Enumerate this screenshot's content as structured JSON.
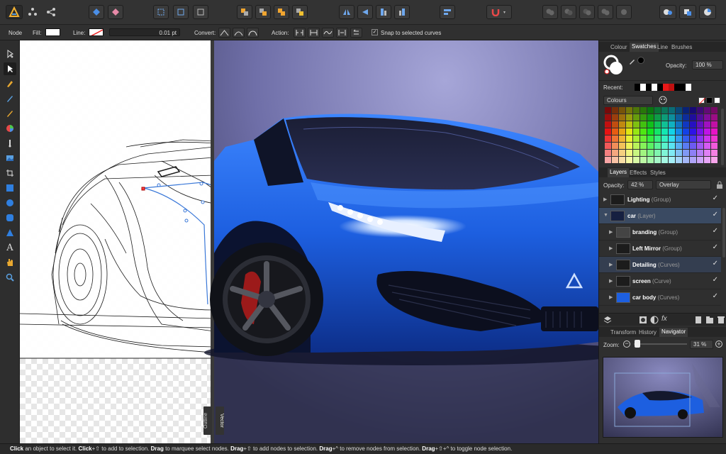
{
  "context_bar": {
    "mode": "Node",
    "fill_label": "Fill:",
    "line_label": "Line:",
    "line_width": "0.01 pt",
    "convert_label": "Convert:",
    "action_label": "Action:",
    "snap_label": "Snap to selected curves"
  },
  "colour_panel": {
    "tabs": [
      "Colour",
      "Swatches",
      "Line",
      "Brushes"
    ],
    "active_tab": "Swatches",
    "opacity_label": "Opacity:",
    "opacity_value": "100 %",
    "recent_label": "Recent:",
    "palette_name": "Colours"
  },
  "layers_panel": {
    "tabs": [
      "Layers",
      "Effects",
      "Styles"
    ],
    "active_tab": "Layers",
    "opacity_label": "Opacity:",
    "opacity_value": "42 %",
    "blend_mode": "Overlay",
    "layers": [
      {
        "name": "Lighting",
        "type": "(Group)"
      },
      {
        "name": "car",
        "type": "(Layer)"
      },
      {
        "name": "branding",
        "type": "(Group)"
      },
      {
        "name": "Left Mirror",
        "type": "(Group)"
      },
      {
        "name": "Detailing",
        "type": "(Curves)"
      },
      {
        "name": "screen",
        "type": "(Curve)"
      },
      {
        "name": "car body",
        "type": "(Curves)"
      }
    ]
  },
  "navigator_panel": {
    "tabs": [
      "Transform",
      "History",
      "Navigator"
    ],
    "active_tab": "Navigator",
    "zoom_label": "Zoom:",
    "zoom_value": "31 %"
  },
  "canvas": {
    "outline_label": "Outline",
    "vector_label": "Vector"
  },
  "status_bar": {
    "parts": [
      {
        "t": "Click",
        "b": true
      },
      {
        "t": " an object to select it. ",
        "b": false
      },
      {
        "t": "Click",
        "b": true
      },
      {
        "t": "+⇧ to add to selection. ",
        "b": false
      },
      {
        "t": "Drag",
        "b": true
      },
      {
        "t": " to marquee select nodes. ",
        "b": false
      },
      {
        "t": "Drag",
        "b": true
      },
      {
        "t": "+⇧ to add nodes to selection. ",
        "b": false
      },
      {
        "t": "Drag",
        "b": true
      },
      {
        "t": "+^ to remove nodes from selection. ",
        "b": false
      },
      {
        "t": "Drag",
        "b": true
      },
      {
        "t": "+⇧+^ to toggle node selection.",
        "b": false
      }
    ]
  },
  "colors": {
    "accent_blue": "#3a6fd8",
    "car_blue": "#1d5fe0",
    "panel_bg": "#2f2f2f",
    "toolbar_bg": "#333333"
  }
}
